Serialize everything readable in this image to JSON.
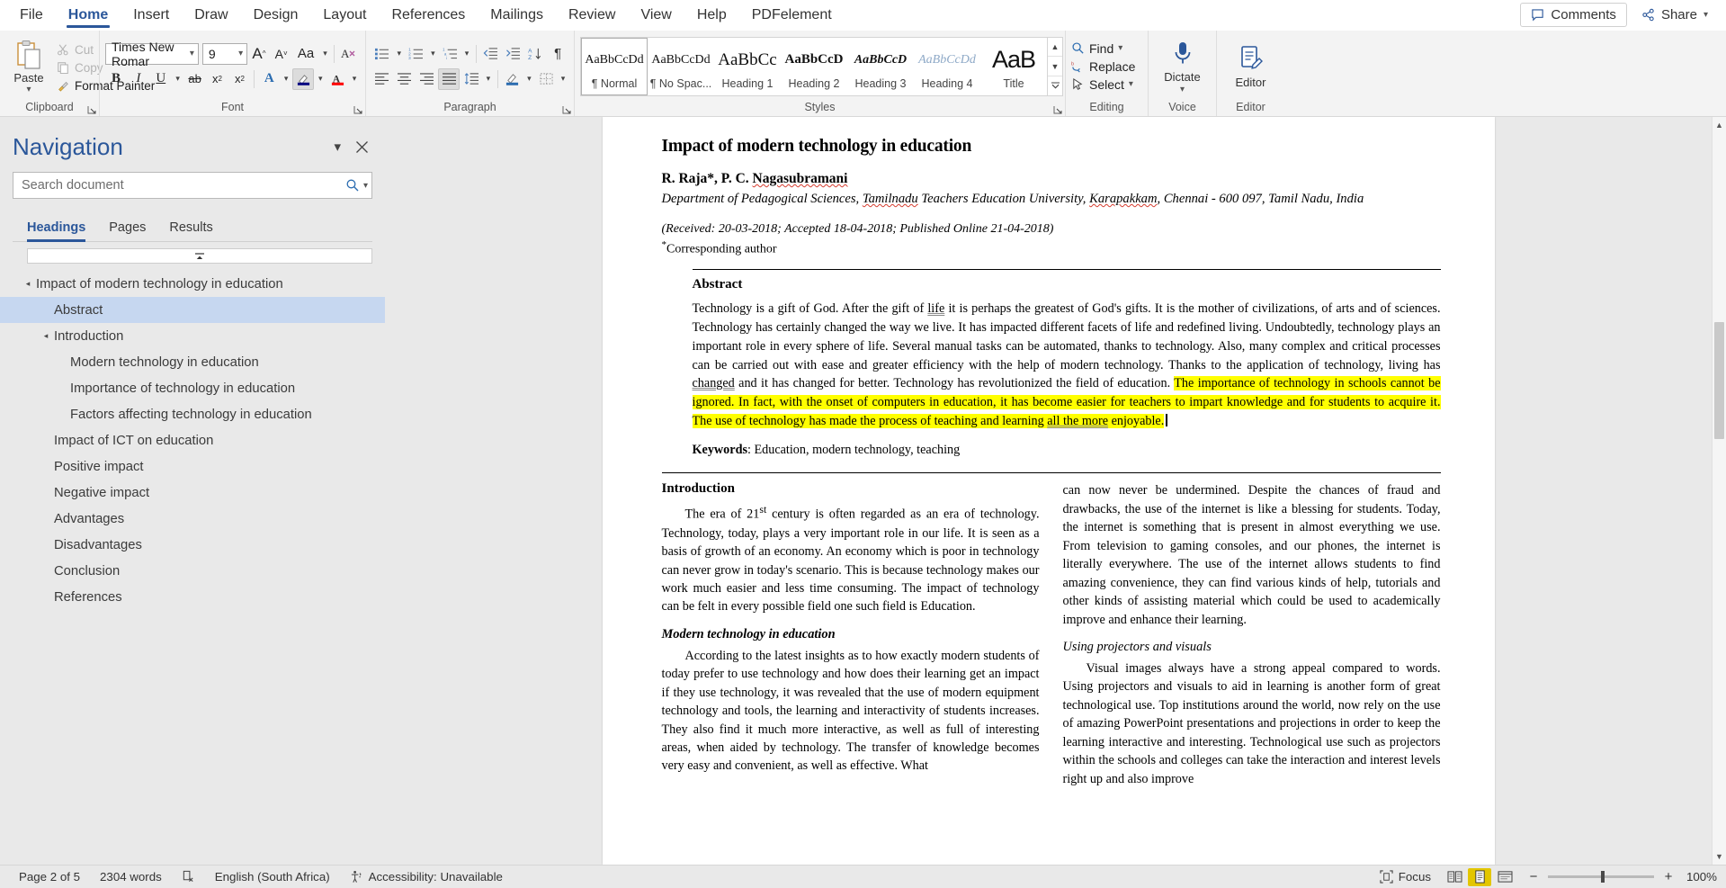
{
  "tabs": [
    {
      "label": "File",
      "active": false
    },
    {
      "label": "Home",
      "active": true
    },
    {
      "label": "Insert",
      "active": false
    },
    {
      "label": "Draw",
      "active": false
    },
    {
      "label": "Design",
      "active": false
    },
    {
      "label": "Layout",
      "active": false
    },
    {
      "label": "References",
      "active": false
    },
    {
      "label": "Mailings",
      "active": false
    },
    {
      "label": "Review",
      "active": false
    },
    {
      "label": "View",
      "active": false
    },
    {
      "label": "Help",
      "active": false
    },
    {
      "label": "PDFelement",
      "active": false
    }
  ],
  "titlebar": {
    "comments_label": "Comments",
    "share_label": "Share",
    "comments_icon": "comment-icon",
    "share_icon": "share-icon",
    "share_chevron": "chevron-down-icon"
  },
  "ribbon": {
    "clipboard": {
      "group_label": "Clipboard",
      "paste_label": "Paste",
      "paste_icon": "paste-icon",
      "cut_label": "Cut",
      "cut_icon": "scissors-icon",
      "copy_label": "Copy",
      "copy_icon": "copy-icon",
      "format_painter_label": "Format Painter",
      "format_painter_icon": "paintbrush-icon",
      "dialog_launcher": "dialog-launcher-icon"
    },
    "font": {
      "group_label": "Font",
      "font_name": "Times New Romar",
      "font_size": "9",
      "grow_font_icon": "grow-font-icon",
      "shrink_font_icon": "shrink-font-icon",
      "change_case_label": "Aa",
      "clear_formatting_icon": "clear-formatting-icon",
      "bold_label": "B",
      "italic_label": "I",
      "underline_label": "U",
      "strikethrough_label": "ab",
      "subscript_label": "x",
      "superscript_label": "x",
      "text_effects_label": "A",
      "highlight_icon": "text-highlight-icon",
      "font_color_label": "A",
      "highlight_color": "#000080",
      "font_color": "#ff0000",
      "dialog_launcher": "dialog-launcher-icon"
    },
    "paragraph": {
      "group_label": "Paragraph",
      "bullets_icon": "bullet-list-icon",
      "numbering_icon": "numbered-list-icon",
      "multilevel_icon": "multilevel-list-icon",
      "decrease_indent_icon": "decrease-indent-icon",
      "increase_indent_icon": "increase-indent-icon",
      "sort_icon": "sort-az-icon",
      "show_marks_icon": "pilcrow-icon",
      "align_left_icon": "align-left-icon",
      "align_center_icon": "align-center-icon",
      "align_right_icon": "align-right-icon",
      "justify_icon": "justify-icon",
      "line_spacing_icon": "line-spacing-icon",
      "shading_icon": "shading-icon",
      "borders_icon": "borders-icon",
      "dialog_launcher": "dialog-launcher-icon"
    },
    "styles": {
      "group_label": "Styles",
      "dialog_launcher": "dialog-launcher-icon",
      "scroll_up_icon": "chevron-up-icon",
      "scroll_down_icon": "chevron-down-icon",
      "more_icon": "more-styles-icon",
      "items": [
        {
          "preview": "AaBbCcDd",
          "name": "¶ Normal",
          "active": true,
          "cls": "sp-normal"
        },
        {
          "preview": "AaBbCcDd",
          "name": "¶ No Spac...",
          "active": false,
          "cls": "sp-nospace"
        },
        {
          "preview": "AaBbCc",
          "name": "Heading 1",
          "active": false,
          "cls": "sp-h1"
        },
        {
          "preview": "AaBbCcD",
          "name": "Heading 2",
          "active": false,
          "cls": "sp-h2"
        },
        {
          "preview": "AaBbCcD",
          "name": "Heading 3",
          "active": false,
          "cls": "sp-h3"
        },
        {
          "preview": "AaBbCcDd",
          "name": "Heading 4",
          "active": false,
          "cls": "sp-h4"
        },
        {
          "preview": "AaB",
          "name": "Title",
          "active": false,
          "cls": "sp-title"
        }
      ]
    },
    "editing": {
      "group_label": "Editing",
      "find_label": "Find",
      "find_icon": "search-icon",
      "replace_label": "Replace",
      "replace_icon": "replace-icon",
      "select_label": "Select",
      "select_icon": "cursor-select-icon",
      "chevron": "chevron-down-icon"
    },
    "voice": {
      "group_label": "Voice",
      "dictate_label": "Dictate",
      "dictate_icon": "microphone-icon"
    },
    "editor_group": {
      "group_label": "Editor",
      "editor_label": "Editor",
      "editor_icon": "editor-pen-icon"
    }
  },
  "navigation": {
    "title": "Navigation",
    "collapse_icon": "chevron-down-icon",
    "close_icon": "close-icon",
    "search_placeholder": "Search document",
    "search_value": "",
    "search_icon": "search-icon",
    "search_chevron": "chevron-down-icon",
    "tabs": [
      {
        "label": "Headings",
        "active": true
      },
      {
        "label": "Pages",
        "active": false
      },
      {
        "label": "Results",
        "active": false
      }
    ],
    "scroll_top_icon": "scroll-to-top-icon",
    "headings": [
      {
        "label": "Impact of modern technology in education",
        "level": 0,
        "expandable": true,
        "selected": false
      },
      {
        "label": "Abstract",
        "level": 1,
        "expandable": false,
        "selected": true
      },
      {
        "label": "Introduction",
        "level": 1,
        "expandable": true,
        "selected": false
      },
      {
        "label": "Modern technology in education",
        "level": 2,
        "expandable": false,
        "selected": false
      },
      {
        "label": "Importance of technology in education",
        "level": 2,
        "expandable": false,
        "selected": false
      },
      {
        "label": "Factors affecting technology in education",
        "level": 2,
        "expandable": false,
        "selected": false
      },
      {
        "label": "Impact of ICT on education",
        "level": 1,
        "expandable": false,
        "selected": false
      },
      {
        "label": "Positive impact",
        "level": 1,
        "expandable": false,
        "selected": false
      },
      {
        "label": "Negative impact",
        "level": 1,
        "expandable": false,
        "selected": false
      },
      {
        "label": "Advantages",
        "level": 1,
        "expandable": false,
        "selected": false
      },
      {
        "label": "Disadvantages",
        "level": 1,
        "expandable": false,
        "selected": false
      },
      {
        "label": "Conclusion",
        "level": 1,
        "expandable": false,
        "selected": false
      },
      {
        "label": "References",
        "level": 1,
        "expandable": false,
        "selected": false
      }
    ]
  },
  "document": {
    "title": "Impact of modern technology in education",
    "authors_pre": "R. Raja*, P. C. ",
    "authors_misspelled": "Nagasubramani",
    "affiliation_1": "Department of Pedagogical Sciences, ",
    "affiliation_mis1": "Tamilnadu",
    "affiliation_2": " Teachers Education University, ",
    "affiliation_mis2": "Karapakkam",
    "affiliation_3": ", Chennai - 600 097, Tamil Nadu, India",
    "dates": "(Received: 20-03-2018; Accepted 18-04-2018; Published Online 21-04-2018)",
    "corresponding": "Corresponding author",
    "abstract_heading": "Abstract",
    "abstract_p1": "Technology is a gift of God. After the gift of ",
    "abstract_grammar1": "life",
    "abstract_p2": " it is perhaps the greatest of God's gifts. It is the mother of civilizations, of arts and of sciences. Technology has certainly changed the way we live. It has impacted different facets of life and redefined living. Undoubtedly, technology plays an important role in every sphere of life. Several manual tasks can be automated, thanks to technology. Also, many complex and critical processes can be carried out with ease and greater efficiency with the help of modern technology. Thanks to the application of technology, living has ",
    "abstract_grammar2": "changed",
    "abstract_p3": " and it has changed for better. Technology has revolutionized the field of education. ",
    "abstract_highlight_1": "The importance of technology in schools cannot be ignored. In fact, with the onset of computers in education, it has become easier for teachers to impart knowledge and for students to acquire it. The use of technology has made the process of teaching and learning ",
    "abstract_highlight_grammar": "all the more",
    "abstract_highlight_2": " enjoyable.",
    "keywords_label": "Keywords",
    "keywords_value": ": Education, modern technology, teaching",
    "intro_heading": "Introduction",
    "intro_p1_a": "The era of 21",
    "intro_p1_sup": "st",
    "intro_p1_b": " century is often regarded as an era of technology. Technology, today, plays a very important role in our life. It is seen as a basis of growth of an economy. An economy which is poor in technology can never grow in today's scenario. This is because technology makes our work much easier and less time consuming. The impact of technology can be felt in every possible field one such field is Education.",
    "modern_tech_heading": "Modern technology in education",
    "modern_tech_p": "According to the latest insights as to how exactly modern students of today prefer to use technology and how does their learning get an impact if they use technology, it was revealed that the use of modern equipment technology and tools, the learning and interactivity of students increases. They also find it much more interactive, as well as full of interesting areas, when aided by technology. The transfer of knowledge becomes very easy and convenient, as well as effective. What",
    "right_col_p1": "can now never be undermined. Despite the chances of fraud and drawbacks, the use of the internet is like a blessing for students. Today, the internet is something that is present in almost everything we use. From television to gaming consoles, and our phones, the internet is literally everywhere. The use of the internet allows students to find amazing convenience, they can find various kinds of help, tutorials and other kinds of assisting material which could be used to academically improve and enhance their learning.",
    "projectors_heading": "Using projectors and visuals",
    "projectors_p": "Visual images always have a strong appeal compared to words. Using projectors and visuals to aid in learning is another form of great technological use. Top institutions around the world, now rely on the use of amazing PowerPoint presentations and projections in order to keep the learning interactive and interesting. Technological use such as projectors within the schools and colleges can take the interaction and interest levels right up and also improve",
    "highlight_color": "#ffff00"
  },
  "status": {
    "page_label": "Page 2 of 5",
    "word_count": "2304 words",
    "proofing_icon": "proofing-errors-icon",
    "language": "English (South Africa)",
    "accessibility_icon": "accessibility-icon",
    "accessibility": "Accessibility: Unavailable",
    "focus_label": "Focus",
    "focus_icon": "focus-mode-icon",
    "view_read_icon": "read-mode-icon",
    "view_print_icon": "print-layout-icon",
    "view_web_icon": "web-layout-icon",
    "zoom_out_label": "−",
    "zoom_in_label": "+",
    "zoom_value": "100%"
  }
}
